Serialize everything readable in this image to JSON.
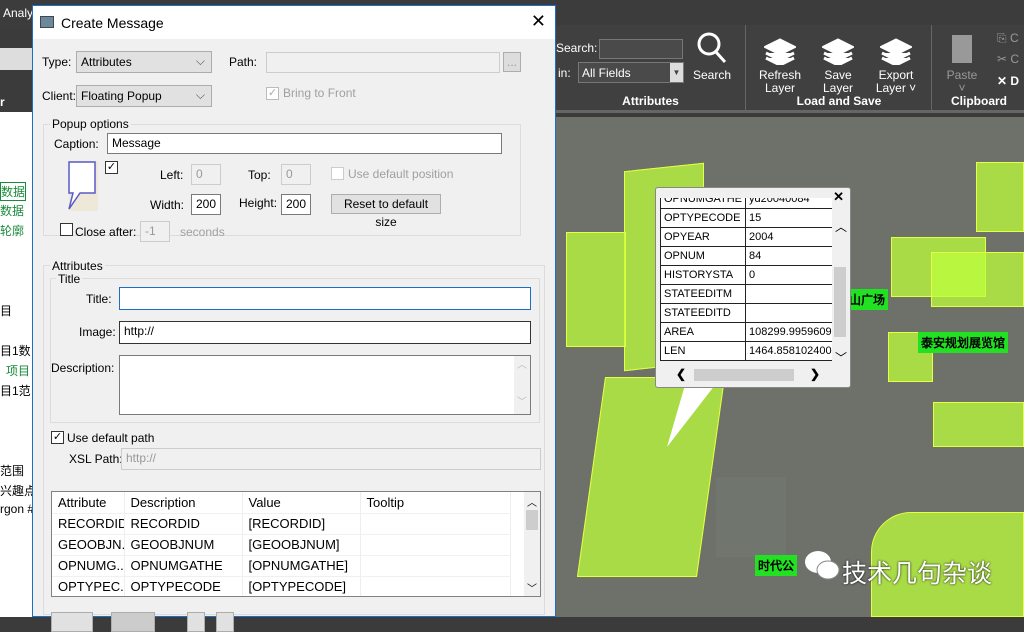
{
  "app": {
    "menu_fragment": "Analy",
    "left_fragments": [
      "r",
      "数据",
      "(E",
      "数据",
      "轮廓",
      "目",
      "目1数",
      "项目",
      "目1范",
      "范围",
      "兴趣点",
      "rgon #"
    ]
  },
  "ribbon": {
    "search_label": "Search:",
    "in_label": "in:",
    "search_field_value": "",
    "in_value": "All Fields",
    "search_button": "Search",
    "attributes_group": "Attributes",
    "refresh_layer": "Refresh Layer",
    "save_layer": "Save Layer",
    "export_layer": "Export Layer",
    "load_save_group": "Load and Save",
    "paste": "Paste",
    "clipboard_group": "Clipboard",
    "delete_fragment": "D",
    "copy_fragment": "C",
    "cut_fragment": "C"
  },
  "dialog": {
    "title": "Create Message",
    "type_label": "Type:",
    "type_value": "Attributes",
    "path_label": "Path:",
    "path_value": "",
    "browse": "...",
    "client_label": "Client:",
    "client_value": "Floating Popup",
    "bring_to_front": "Bring to Front",
    "bring_to_front_checked": true,
    "popup_options": "Popup options",
    "caption_label": "Caption:",
    "caption_value": "Message",
    "show_preview_checked": true,
    "left_label": "Left:",
    "left_value": "0",
    "top_label": "Top:",
    "top_value": "0",
    "use_default_position": "Use default position",
    "width_label": "Width:",
    "width_value": "200",
    "height_label": "Height:",
    "height_value": "200",
    "reset_size": "Reset to default size",
    "close_after": "Close after:",
    "close_after_value": "-1",
    "seconds": "seconds",
    "close_after_checked": false,
    "attributes_group": "Attributes",
    "title_group": "Title",
    "title_label": "Title:",
    "title_value": "",
    "image_label": "Image:",
    "image_value": "http://",
    "description_label": "Description:",
    "description_value": "",
    "use_default_path": "Use default path",
    "use_default_path_checked": true,
    "xsl_label": "XSL Path:",
    "xsl_value": "http://",
    "grid": {
      "columns": [
        "Attribute",
        "Description",
        "Value",
        "Tooltip"
      ],
      "rows": [
        [
          "RECORDID",
          "RECORDID",
          "[RECORDID]",
          ""
        ],
        [
          "GEOOBJN...",
          "GEOOBJNUM",
          "[GEOOBJNUM]",
          ""
        ],
        [
          "OPNUMG...",
          "OPNUMGATHE",
          "[OPNUMGATHE]",
          ""
        ],
        [
          "OPTYPEC...",
          "OPTYPECODE",
          "[OPTYPECODE]",
          ""
        ]
      ]
    }
  },
  "popup": {
    "rows": [
      [
        "OPNUMGATHE",
        "yd20040084"
      ],
      [
        "OPTYPECODE",
        "15"
      ],
      [
        "OPYEAR",
        "2004"
      ],
      [
        "OPNUM",
        "84"
      ],
      [
        "HISTORYSTA",
        "0"
      ],
      [
        "STATEEDITM",
        ""
      ],
      [
        "STATEEDITD",
        ""
      ],
      [
        "AREA",
        "108299.995960999"
      ],
      [
        "LEN",
        "1464.85810240000"
      ]
    ]
  },
  "map": {
    "labels": [
      "山广场",
      "泰安规划展览馆",
      "时代公"
    ],
    "watermark": "技术几句杂谈"
  },
  "colors": {
    "ribbon": "#404040",
    "polygon": "#beff3c",
    "label_bg": "#22e022",
    "dialog_border": "#1c6fc4"
  }
}
